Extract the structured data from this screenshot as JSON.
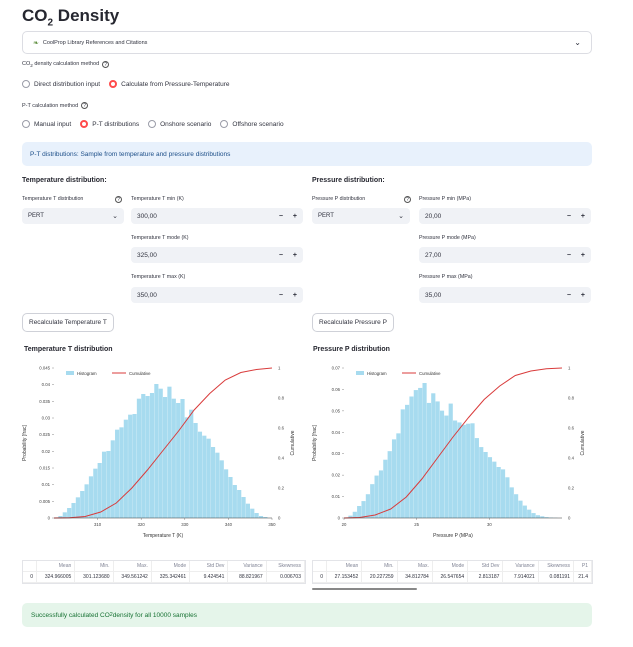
{
  "page": {
    "title_main": "CO",
    "title_sub": "2",
    "title_rest": " Density"
  },
  "expander": {
    "icon": "book-leaf-icon",
    "label": "CoolProp Library References and Citations"
  },
  "method": {
    "label_pre": "CO",
    "label_sub": "2",
    "label_rest": " density calculation method",
    "options": [
      "Direct distribution input",
      "Calculate from Pressure-Temperature"
    ],
    "selected": "Calculate from Pressure-Temperature"
  },
  "pt_method": {
    "label": "P-T calculation method",
    "options": [
      "Manual input",
      "P-T distributions",
      "Onshore scenario",
      "Offshore scenario"
    ],
    "selected": "P-T distributions"
  },
  "info": {
    "text": "P-T distributions: Sample from temperature and pressure distributions"
  },
  "temperature": {
    "heading": "Temperature distribution:",
    "dist_label": "Temperature T distribution",
    "dist_value": "PERT",
    "min_label": "Temperature T min (K)",
    "min_value": "300,00",
    "mode_label": "Temperature T mode (K)",
    "mode_value": "325,00",
    "max_label": "Temperature T max (K)",
    "max_value": "350,00",
    "button": "Recalculate Temperature T"
  },
  "pressure": {
    "heading": "Pressure distribution:",
    "dist_label": "Pressure P distribution",
    "dist_value": "PERT",
    "min_label": "Pressure P min (MPa)",
    "min_value": "20,00",
    "mode_label": "Pressure P mode (MPa)",
    "mode_value": "27,00",
    "max_label": "Pressure P max (MPa)",
    "max_value": "35,00",
    "button": "Recalculate Pressure P"
  },
  "chart_data": [
    {
      "type": "bar",
      "title": "Temperature T distribution",
      "xlabel": "Temperature T (K)",
      "ylabel": "Probability [frac]",
      "y2label": "Cumulative",
      "legend": [
        "Histogram",
        "Cumulative"
      ],
      "legend_position": "top-left",
      "xlim": [
        300,
        350
      ],
      "ylim": [
        0,
        0.045
      ],
      "y2lim": [
        0,
        1
      ],
      "xticks": [
        "310",
        "320",
        "330",
        "340",
        "350"
      ],
      "yticks": [
        "0",
        "0.005",
        "0.01",
        "0.015",
        "0.02",
        "0.025",
        "0.03",
        "0.035",
        "0.04",
        "0.045"
      ],
      "y2ticks": [
        "0",
        "0.2",
        "0.4",
        "0.6",
        "0.8",
        "1"
      ],
      "x": [
        301.5,
        302.5,
        303.5,
        304.5,
        305.5,
        306.5,
        307.5,
        308.5,
        309.5,
        310.5,
        311.5,
        312.5,
        313.5,
        314.5,
        315.5,
        316.5,
        317.5,
        318.5,
        319.5,
        320.5,
        321.5,
        322.5,
        323.5,
        324.5,
        325.5,
        326.5,
        327.5,
        328.5,
        329.5,
        330.5,
        331.5,
        332.5,
        333.5,
        334.5,
        335.5,
        336.5,
        337.5,
        338.5,
        339.5,
        340.5,
        341.5,
        342.5,
        343.5,
        344.5,
        345.5,
        346.5,
        347.5,
        348.5
      ],
      "values": [
        0.0006,
        0.0017,
        0.003,
        0.0045,
        0.0062,
        0.0081,
        0.0101,
        0.0125,
        0.0148,
        0.0165,
        0.0199,
        0.0201,
        0.0233,
        0.0265,
        0.0272,
        0.0295,
        0.031,
        0.0312,
        0.0358,
        0.0372,
        0.0366,
        0.0375,
        0.0402,
        0.0388,
        0.0363,
        0.0394,
        0.0358,
        0.0345,
        0.0357,
        0.0302,
        0.0325,
        0.0285,
        0.0259,
        0.0247,
        0.0238,
        0.0213,
        0.0196,
        0.0173,
        0.0146,
        0.0123,
        0.0099,
        0.0084,
        0.0063,
        0.0043,
        0.0028,
        0.0015,
        0.0006,
        0.0003
      ],
      "cumulative": [
        0.0,
        0.002,
        0.01,
        0.04,
        0.1,
        0.2,
        0.32,
        0.45,
        0.58,
        0.72,
        0.83,
        0.92,
        0.97,
        0.99,
        1.0
      ]
    },
    {
      "type": "bar",
      "title": "Pressure P distribution",
      "xlabel": "Pressure P (MPa)",
      "ylabel": "Probability [frac]",
      "y2label": "Cumulative",
      "legend": [
        "Histogram",
        "Cumulative"
      ],
      "legend_position": "top-left",
      "xlim": [
        20,
        35
      ],
      "ylim": [
        0,
        0.07
      ],
      "y2lim": [
        0,
        1
      ],
      "xticks": [
        "20",
        "25",
        "30"
      ],
      "yticks": [
        "0",
        "0.01",
        "0.02",
        "0.03",
        "0.04",
        "0.05",
        "0.06",
        "0.07"
      ],
      "y2ticks": [
        "0",
        "0.2",
        "0.4",
        "0.6",
        "0.8",
        "1"
      ],
      "x": [
        20.45,
        20.75,
        21.05,
        21.35,
        21.65,
        21.95,
        22.25,
        22.55,
        22.85,
        23.15,
        23.45,
        23.75,
        24.05,
        24.35,
        24.65,
        24.95,
        25.25,
        25.55,
        25.85,
        26.15,
        26.45,
        26.75,
        27.05,
        27.35,
        27.65,
        27.95,
        28.25,
        28.55,
        28.85,
        29.15,
        29.45,
        29.75,
        30.05,
        30.35,
        30.65,
        30.95,
        31.25,
        31.55,
        31.85,
        32.15,
        32.45,
        32.75,
        33.05,
        33.35,
        33.65,
        33.95,
        34.25,
        34.55
      ],
      "values": [
        0.0011,
        0.0029,
        0.0056,
        0.0079,
        0.0111,
        0.0158,
        0.0198,
        0.0222,
        0.0272,
        0.0312,
        0.0367,
        0.0395,
        0.0507,
        0.0528,
        0.0567,
        0.0597,
        0.0607,
        0.063,
        0.0537,
        0.0582,
        0.0544,
        0.0501,
        0.0478,
        0.0534,
        0.0455,
        0.0446,
        0.0435,
        0.044,
        0.0442,
        0.0373,
        0.0331,
        0.0308,
        0.0284,
        0.0263,
        0.0238,
        0.0227,
        0.019,
        0.0143,
        0.0111,
        0.0081,
        0.0058,
        0.0039,
        0.0023,
        0.0013,
        0.0008,
        0.0004,
        0.0002,
        0.0001
      ],
      "cumulative": [
        0.0,
        0.003,
        0.02,
        0.06,
        0.14,
        0.26,
        0.4,
        0.54,
        0.67,
        0.79,
        0.88,
        0.95,
        0.98,
        0.995,
        1.0
      ]
    }
  ],
  "stats_t": {
    "headers": [
      "",
      "Mean",
      "Min.",
      "Max.",
      "Mode",
      "Std Dev",
      "Variance",
      "Skewness"
    ],
    "row": [
      "0",
      "324.966005",
      "301.123680",
      "349.561242",
      "325.342461",
      "9.424541",
      "88.821967",
      "0.006703"
    ]
  },
  "stats_p": {
    "headers": [
      "",
      "Mean",
      "Min.",
      "Max.",
      "Mode",
      "Std Dev",
      "Variance",
      "Skewness",
      "P1"
    ],
    "row": [
      "0",
      "27.153452",
      "20.227259",
      "34.812784",
      "26.547654",
      "2.813187",
      "7.914021",
      "0.081191",
      "21.4"
    ]
  },
  "success": {
    "pre": "Successfully calculated CO",
    "sub": "2",
    "post": " density for all 10000 samples"
  },
  "colors": {
    "histogram": "#a7dbef",
    "cumulative": "#d93b3b",
    "accent": "#ff4b4b"
  }
}
